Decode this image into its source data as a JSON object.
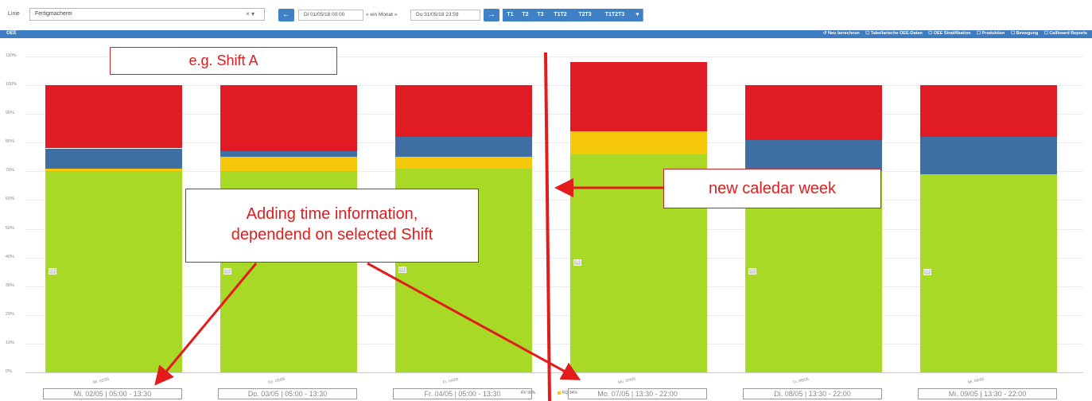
{
  "toolbar": {
    "line_label": "Linie",
    "line_value": "Fertigmacherei",
    "clear_symbol": "× ▾",
    "prev_icon": "arrow-left-icon",
    "next_icon": "arrow-right-icon",
    "date_from": "Di 01/05/18 00:00",
    "range_text": "« ein Monat »",
    "date_to": "Do 31/05/18 23:59",
    "shift_buttons": [
      "T1",
      "T2",
      "T3",
      "T1T2",
      "T2T3",
      "T1T2T3"
    ],
    "dropdown_symbol": "▾",
    "accent_color": "#3f81c4"
  },
  "panel": {
    "title": "OEE",
    "links": [
      "↺ Neu berechnen",
      "☐ Tabellarische OEE-Daten",
      "☐ OEE Stratifikation",
      "☐ Produktion",
      "☐ Bewegung",
      "☐ Callboard Reports"
    ]
  },
  "annotations": {
    "shift_box": "e.g. Shift A",
    "week_box": "new caledar week",
    "time_info_line1": "Adding time information,",
    "time_info_line2": "dependend on selected Shift",
    "color": "#e31b1b"
  },
  "legend": {
    "rv": "RV 96%",
    "rq": "RQ 94%"
  },
  "chart_data": {
    "type": "bar",
    "stacked": true,
    "categories": [
      "Mi. 02/05",
      "Do. 03/05",
      "Fr. 04/05",
      "Mo. 07/05",
      "Di. 08/05",
      "Mi. 09/05"
    ],
    "category_labels": [
      "Mi. 02/05",
      "Do. 03/05",
      "Fr. 04/05",
      "Mo. 07/05",
      "Di. 08/05",
      "Mi. 09/05"
    ],
    "time_labels": [
      "Mi. 02/05 | 05:00 - 13:30",
      "Do. 03/05 | 05:00 - 13:30",
      "Fr. 04/05 | 05:00 - 13:30",
      "Mo. 07/05 | 13:30 - 22:00",
      "Di. 08/05 | 13:30 - 22:00",
      "Mi. 09/05 | 13:30 - 22:00"
    ],
    "series": [
      {
        "color": "#a8d926",
        "values": [
          70,
          70,
          71,
          76,
          70,
          69
        ]
      },
      {
        "color": "#f5c90a",
        "values": [
          1,
          5,
          4,
          8,
          0,
          0
        ]
      },
      {
        "color": "#3f6ea3",
        "values": [
          7,
          2,
          7,
          0,
          11,
          13
        ]
      },
      {
        "color": "#e01b24",
        "values": [
          22,
          23,
          18,
          24,
          19,
          18
        ]
      }
    ],
    "segment_labels": [
      "69",
      "70",
      "71",
      "76",
      "70",
      "69"
    ],
    "yticks": [
      "110%",
      "100%",
      "90%",
      "80%",
      "70%",
      "60%",
      "50%",
      "40%",
      "30%",
      "20%",
      "10%",
      "0%"
    ],
    "ylim": [
      0,
      110
    ],
    "grid": true
  }
}
